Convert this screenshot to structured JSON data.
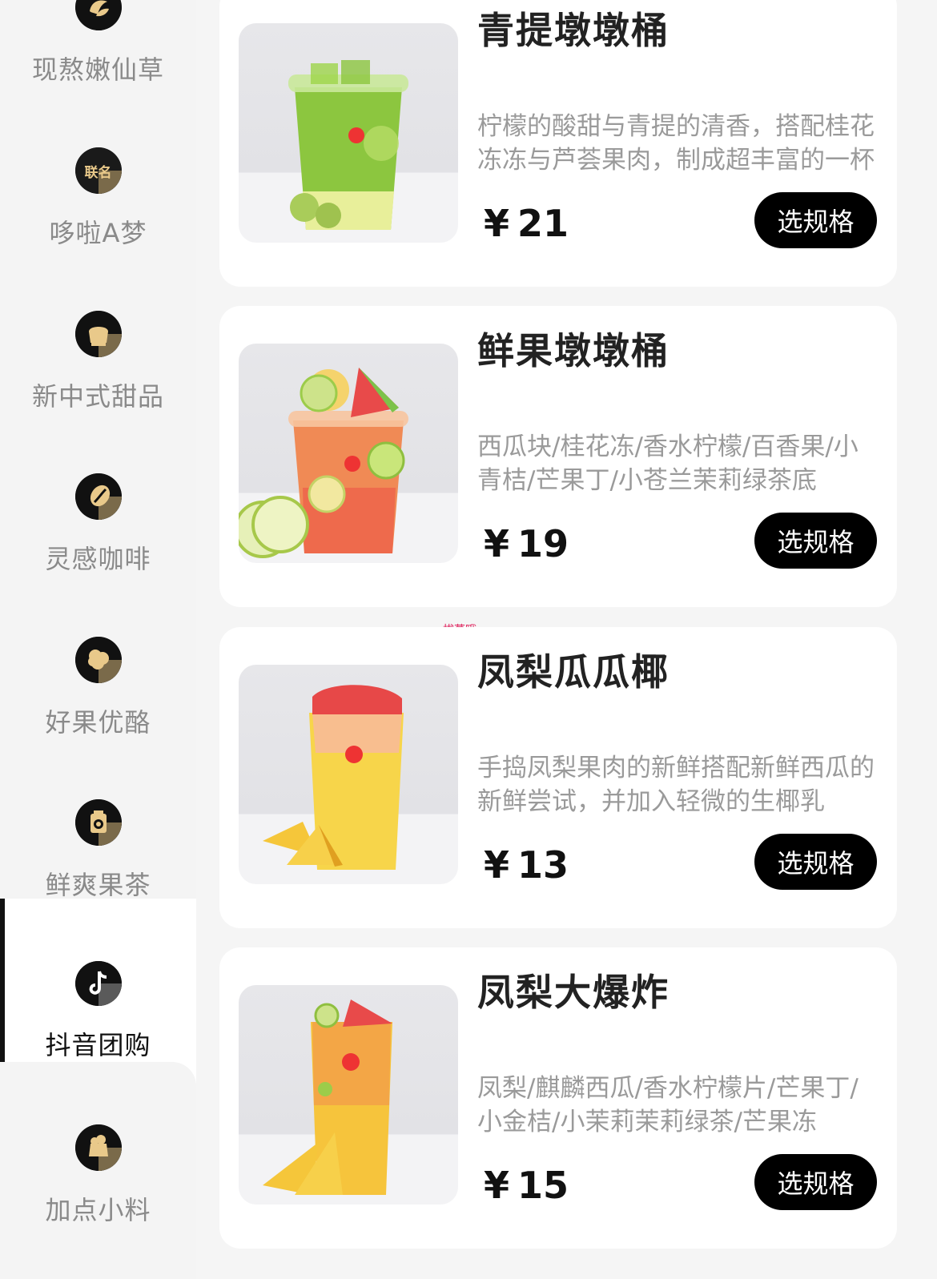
{
  "sidebar": {
    "categories": [
      {
        "label": "现熬嫩仙草",
        "icon": "grass-jelly-icon",
        "active": false
      },
      {
        "label": "哆啦A梦",
        "icon": "collab-badge-icon",
        "badge": "联名",
        "active": false
      },
      {
        "label": "新中式甜品",
        "icon": "dessert-icon",
        "active": false
      },
      {
        "label": "灵感咖啡",
        "icon": "coffee-bean-icon",
        "active": false
      },
      {
        "label": "好果优酪",
        "icon": "fruit-yogurt-icon",
        "active": false
      },
      {
        "label": "鲜爽果茶",
        "icon": "fruit-tea-icon",
        "active": false
      },
      {
        "label": "抖音团购",
        "icon": "douyin-icon",
        "active": true
      },
      {
        "label": "加点小料",
        "icon": "toppings-icon",
        "active": false
      }
    ]
  },
  "products": [
    {
      "name": "青提墩墩桶",
      "desc": "柠檬的酸甜与青提的清香，搭配桂花冻冻与芦荟果肉，制成超丰富的一杯",
      "currency": "¥",
      "price": "21",
      "button": "选规格",
      "image": "green-grape-drink"
    },
    {
      "name": "鲜果墩墩桶",
      "desc": "西瓜块/桂花冻/香水柠檬/百香果/小青桔/芒果丁/小苍兰茉莉绿茶底",
      "currency": "¥",
      "price": "19",
      "button": "选规格",
      "image": "fresh-fruit-drink"
    },
    {
      "name": "凤梨瓜瓜椰",
      "desc": "手捣凤梨果肉的新鲜搭配新鲜西瓜的新鲜尝试，并加入轻微的生椰乳",
      "currency": "¥",
      "price": "13",
      "button": "选规格",
      "image": "pineapple-watermelon-drink"
    },
    {
      "name": "凤梨大爆炸",
      "desc": "凤梨/麒麟西瓜/香水柠檬片/芒果丁/小金桔/小茉莉茉莉绿茶/芒果冻",
      "currency": "¥",
      "price": "15",
      "button": "选规格",
      "image": "pineapple-burst-drink"
    }
  ],
  "watermark": "拔草哦",
  "colors": {
    "accent": "#000000",
    "icon_gold": "#e9c98a",
    "muted_text": "#9a9a9a"
  }
}
